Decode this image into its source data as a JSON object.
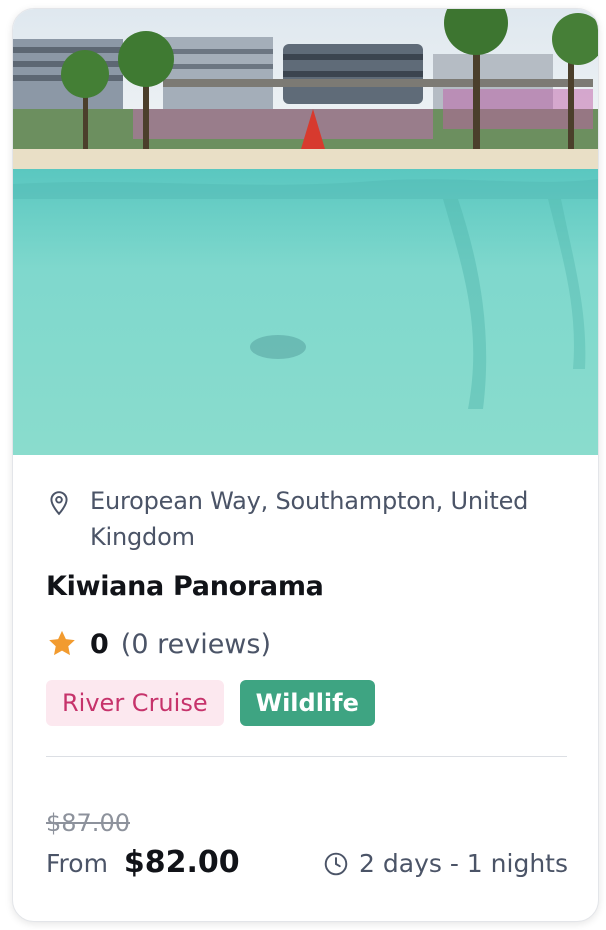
{
  "card": {
    "image_alt": "Lagoon beach with turquoise water and city buildings",
    "location": "European Way, Southampton, United Kingdom",
    "title": "Kiwiana Panorama",
    "rating": {
      "score": "0",
      "reviews": "(0 reviews)"
    },
    "tags": [
      {
        "label": "River Cruise",
        "color": "#fce8ef",
        "text_color": "#c6336b"
      },
      {
        "label": "Wildlife",
        "color": "#3ea482",
        "text_color": "#ffffff"
      }
    ],
    "price": {
      "old": "$87.00",
      "from_label": "From",
      "current": "$82.00"
    },
    "duration": "2 days - 1 nights"
  },
  "icons": {
    "location": "map-pin-icon",
    "rating": "star-icon",
    "duration": "clock-icon"
  },
  "colors": {
    "star": "#f29b2f",
    "text_primary": "#111318",
    "text_secondary": "#4b5467"
  }
}
